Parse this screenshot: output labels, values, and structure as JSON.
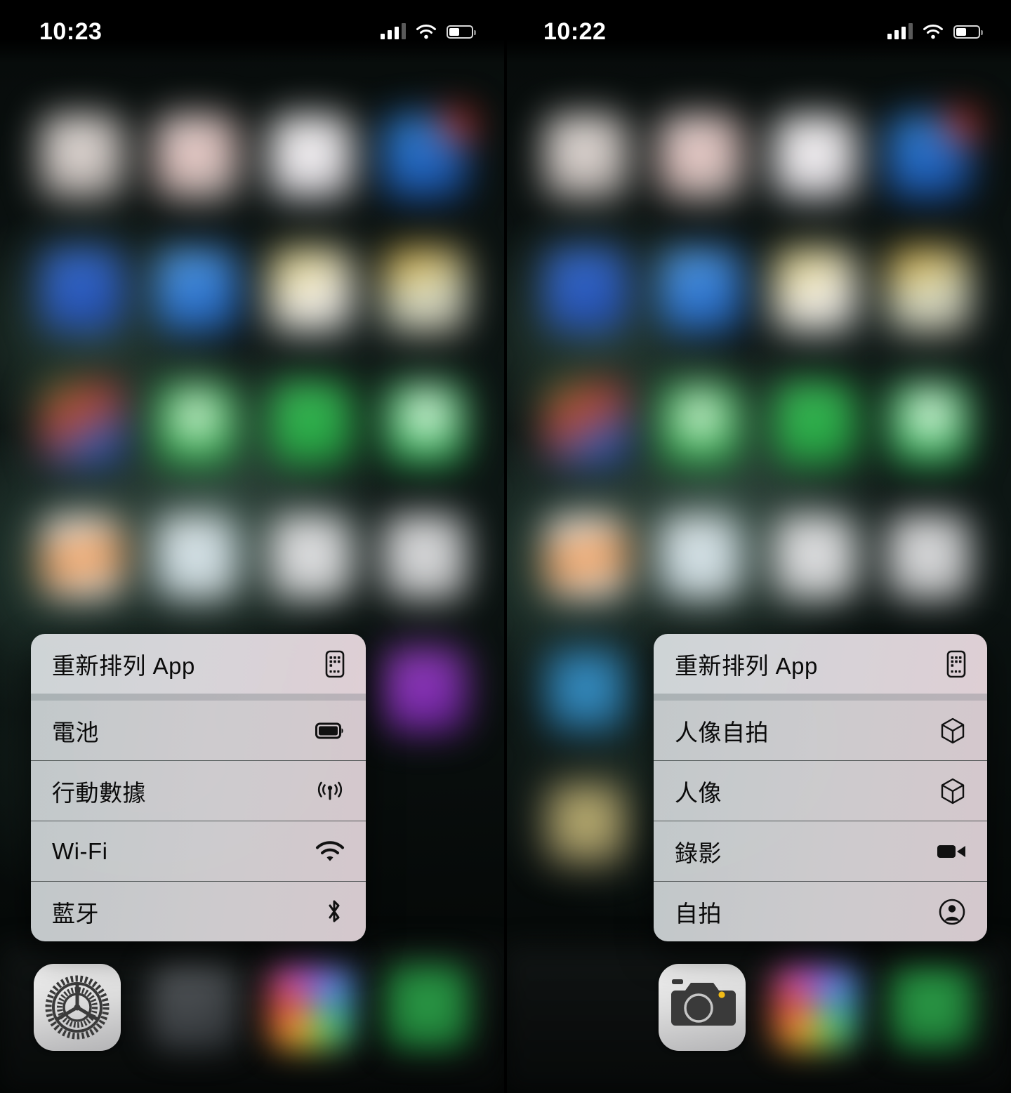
{
  "panels": [
    {
      "id": "left",
      "status": {
        "time": "10:23",
        "signal_icon": "cellular-signal-icon",
        "wifi_icon": "wifi-icon",
        "battery_icon": "battery-icon",
        "battery_level_pct": 48
      },
      "context_menu": {
        "header": {
          "label": "重新排列 App",
          "icon": "rearrange-apps-icon"
        },
        "items": [
          {
            "label": "電池",
            "icon": "battery-icon"
          },
          {
            "label": "行動數據",
            "icon": "cellular-data-icon"
          },
          {
            "label": "Wi-Fi",
            "icon": "wifi-icon"
          },
          {
            "label": "藍牙",
            "icon": "bluetooth-icon"
          }
        ]
      },
      "dock": {
        "focused_app": "settings-gear-icon",
        "blurred_apps": [
          "phone-app",
          "photos-app",
          "messages-app"
        ]
      }
    },
    {
      "id": "right",
      "status": {
        "time": "10:22",
        "signal_icon": "cellular-signal-icon",
        "wifi_icon": "wifi-icon",
        "battery_icon": "battery-icon",
        "battery_level_pct": 48
      },
      "context_menu": {
        "header": {
          "label": "重新排列 App",
          "icon": "rearrange-apps-icon"
        },
        "items": [
          {
            "label": "人像自拍",
            "icon": "cube-icon"
          },
          {
            "label": "人像",
            "icon": "cube-icon"
          },
          {
            "label": "錄影",
            "icon": "video-camera-icon"
          },
          {
            "label": "自拍",
            "icon": "person-circle-icon"
          }
        ]
      },
      "dock": {
        "focused_app": "camera-icon",
        "blurred_apps": [
          "photos-app",
          "messages-app"
        ]
      }
    }
  ],
  "wallpaper": {
    "description": "blurred dark green foliage home screen",
    "icon_rows": [
      [
        "#d8d4d2",
        "#dcd0cd",
        "#e4e2e6",
        "#2a74c8"
      ],
      [
        "#2a5ab4",
        "#3e8ae0",
        "#ddd6b4",
        "#d8b43c"
      ],
      [
        "#4a7f3e",
        "#2ea84a",
        "#2da048",
        "#2fb054"
      ],
      [
        "#e8883a",
        "#cfd9dc",
        "#d2d4d6",
        "#c9cbcd"
      ],
      [
        "#2a6ea8",
        "#b8a268"
      ]
    ],
    "badge_color": "#e0392c"
  },
  "accent_colors": {
    "menu_bg": "#d4d6d8",
    "menu_text": "#0b0b0b",
    "separator": "#8c8f91",
    "status_text": "#ffffff"
  }
}
